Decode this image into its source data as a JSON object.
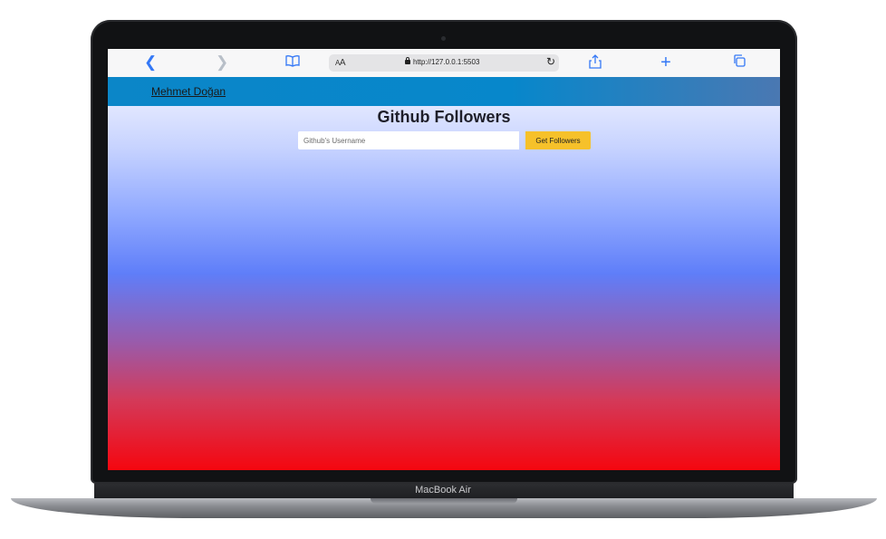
{
  "device": {
    "model_label": "MacBook Air"
  },
  "browser": {
    "back_icon": "chevron-left-icon",
    "forward_icon": "chevron-right-icon",
    "bookmarks_icon": "book-icon",
    "text_size_label_small": "A",
    "text_size_label_large": "A",
    "url": "http://127.0.0.1:5503",
    "reload_icon": "reload-icon",
    "share_icon": "share-icon",
    "new_tab_icon": "plus-icon",
    "tabs_icon": "tabs-icon"
  },
  "page": {
    "navbar": {
      "brand": "Mehmet Doğan",
      "color": "#0787cb"
    },
    "title": "Github Followers",
    "search": {
      "placeholder": "Github's Username",
      "value": ""
    },
    "button": {
      "label": "Get Followers",
      "color": "#f6c12a"
    }
  }
}
